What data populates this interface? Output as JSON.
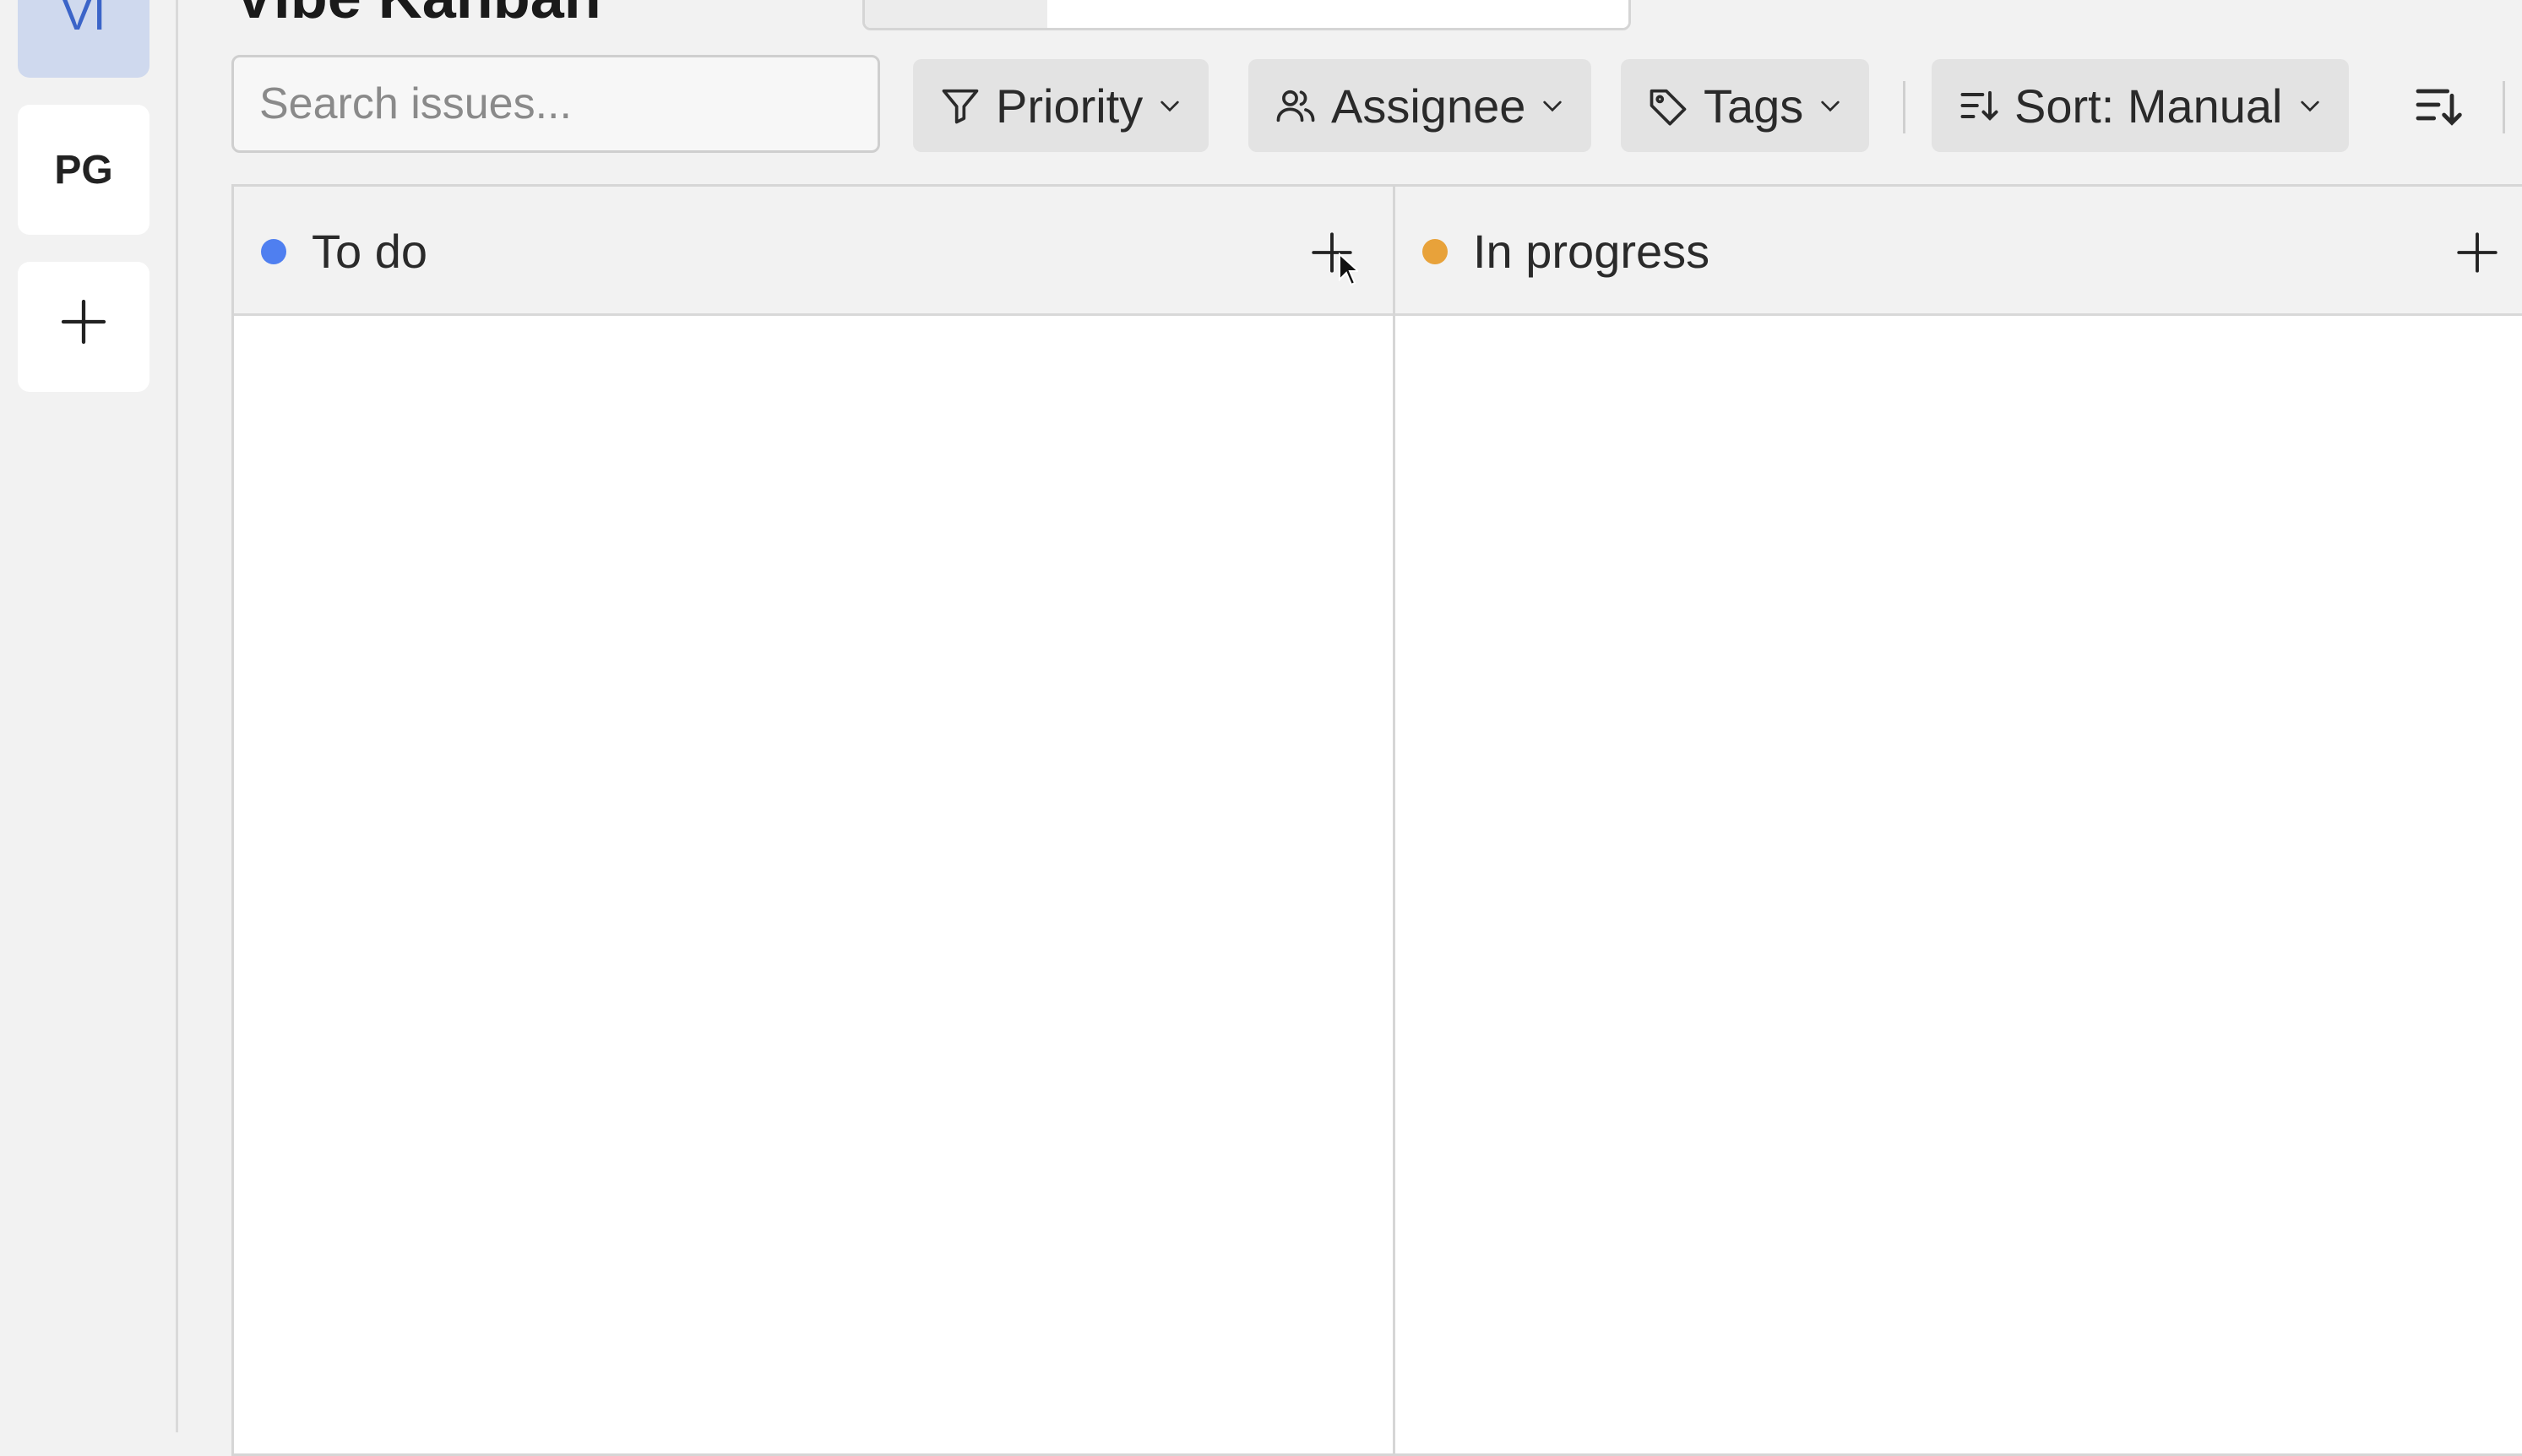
{
  "app": {
    "title": "Vibe Kanban"
  },
  "sidebar": {
    "workspaces": [
      {
        "initials": "VI",
        "active": true
      },
      {
        "initials": "PG",
        "active": false
      }
    ],
    "add_button_icon": "plus-icon"
  },
  "toolbar": {
    "search_placeholder": "Search issues...",
    "filters": [
      {
        "label": "Priority",
        "icon": "funnel-icon"
      },
      {
        "label": "Assignee",
        "icon": "users-icon"
      },
      {
        "label": "Tags",
        "icon": "tag-icon"
      }
    ],
    "sort_label": "Sort: Manual",
    "sort_direction_icon": "sort-descending-icon"
  },
  "columns": [
    {
      "name": "To do",
      "color": "#4f7ff0",
      "issues": []
    },
    {
      "name": "In progress",
      "color": "#e8a23a",
      "issues": []
    }
  ],
  "colors": {
    "accent": "#3b64c8",
    "background": "#f2f2f2",
    "board": "#ffffff"
  }
}
